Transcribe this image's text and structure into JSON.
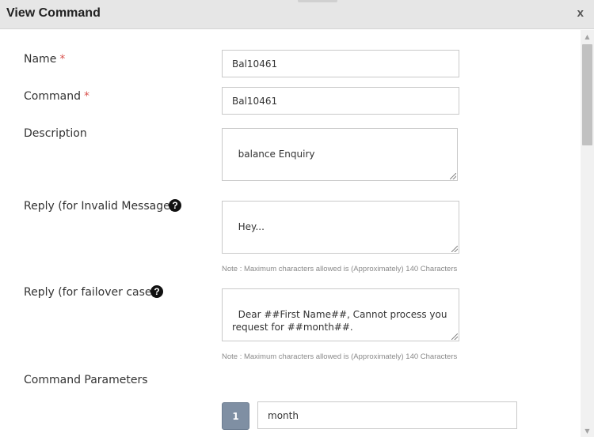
{
  "dialog": {
    "title": "View Command",
    "close_label": "x"
  },
  "form": {
    "name": {
      "label": "Name",
      "required": "*",
      "value": "Bal10461"
    },
    "command": {
      "label": "Command",
      "required": "*",
      "value": "Bal10461"
    },
    "description": {
      "label": "Description",
      "value": "balance Enquiry"
    },
    "reply_invalid": {
      "label": "Reply (for Invalid Message)",
      "value": "Hey...",
      "note": "Note : Maximum characters allowed is (Approximately) 140 Characters"
    },
    "reply_failover": {
      "label": "Reply (for failover case)",
      "value": "Dear ##First Name##, Cannot process you request for ##month##.",
      "note": "Note : Maximum characters allowed is (Approximately) 140 Characters"
    },
    "command_parameters": {
      "label": "Command Parameters",
      "items": [
        {
          "index": "1",
          "value": "month"
        }
      ]
    }
  },
  "icons": {
    "help": "question-circle-icon",
    "help_glyph": "?"
  },
  "colors": {
    "required": "#d9534f",
    "badge": "#7f8fa3",
    "titlebar": "#e6e6e6"
  }
}
